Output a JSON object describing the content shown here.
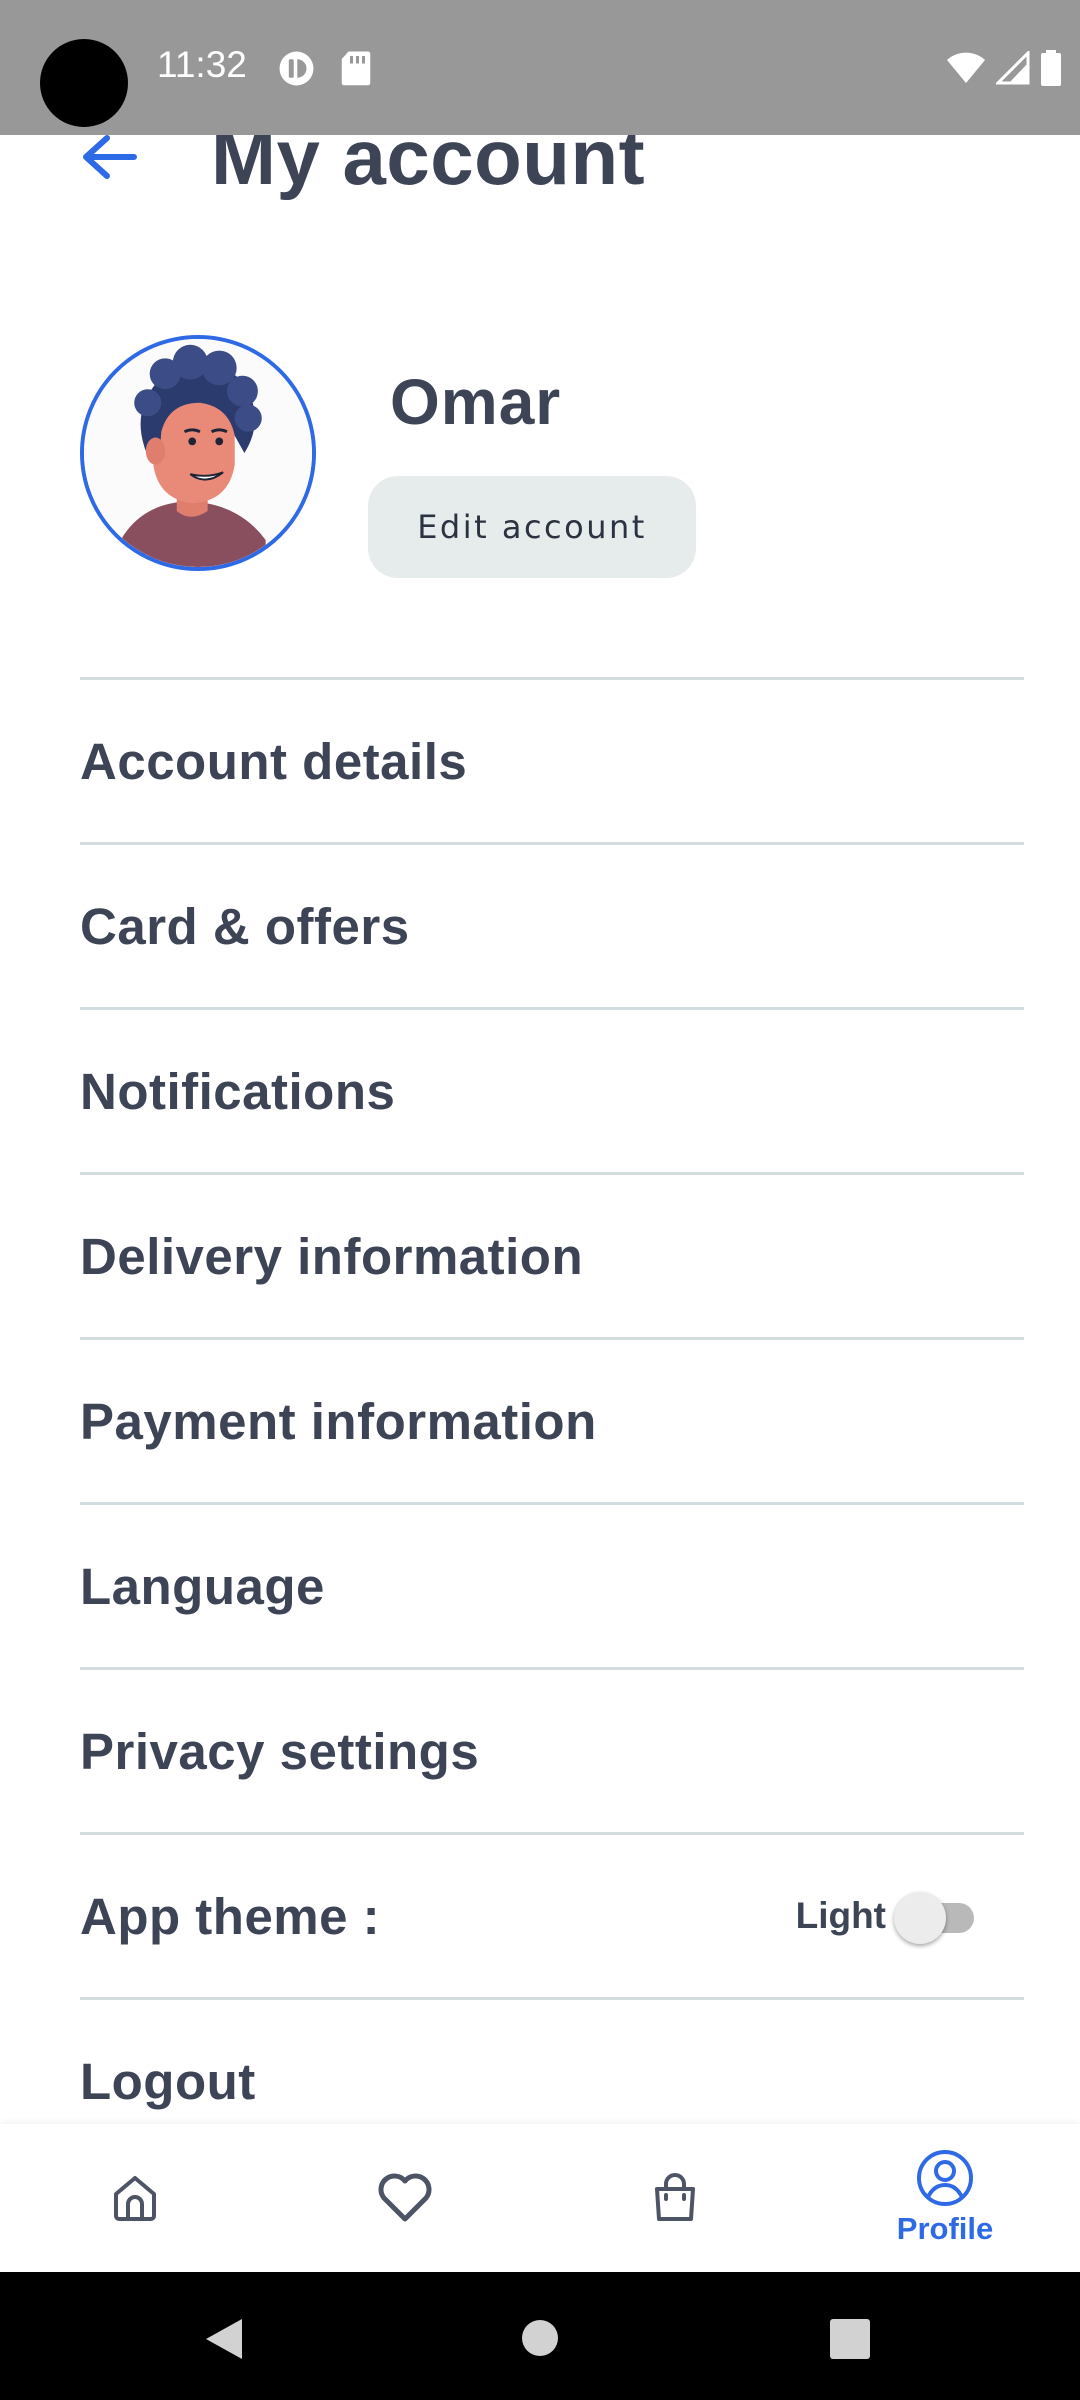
{
  "status_bar": {
    "time": "11:32"
  },
  "header": {
    "title": "My account"
  },
  "profile": {
    "name": "Omar",
    "edit_label": "Edit account"
  },
  "menu": {
    "items": [
      {
        "label": "Account details"
      },
      {
        "label": "Card & offers"
      },
      {
        "label": "Notifications"
      },
      {
        "label": "Delivery information"
      },
      {
        "label": "Payment information"
      },
      {
        "label": "Language"
      },
      {
        "label": "Privacy settings"
      },
      {
        "label": "App theme :"
      },
      {
        "label": "Logout"
      }
    ],
    "theme_value": "Light",
    "theme_toggle_on": false
  },
  "bottom_nav": {
    "items": [
      {
        "icon": "home-icon",
        "label": ""
      },
      {
        "icon": "heart-icon",
        "label": ""
      },
      {
        "icon": "shopping-bag-icon",
        "label": ""
      },
      {
        "icon": "profile-icon",
        "label": "Profile",
        "active": true
      }
    ]
  },
  "colors": {
    "accent": "#2f6ae6",
    "text": "#3c4456",
    "divider": "#d3dde0",
    "button_bg": "#e6ebec",
    "status_bar": "#989898"
  }
}
